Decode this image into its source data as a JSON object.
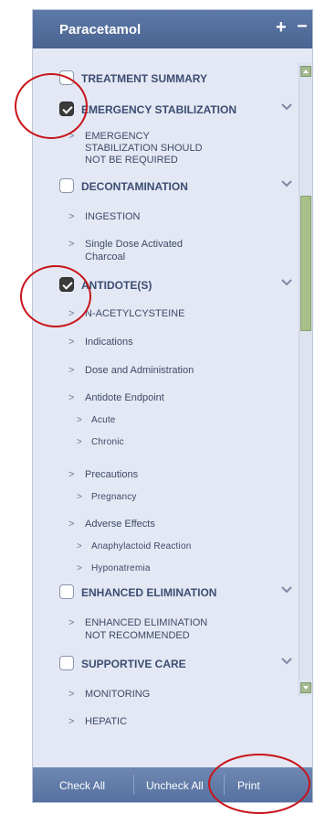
{
  "panel": {
    "title": "Paracetamol",
    "expand_symbol": "+",
    "collapse_symbol": "−"
  },
  "sections": [
    {
      "label": "TREATMENT SUMMARY",
      "checked": false
    },
    {
      "label": "EMERGENCY STABILIZATION",
      "checked": true
    },
    {
      "label": "DECONTAMINATION",
      "checked": false
    },
    {
      "label": "ANTIDOTE(S)",
      "checked": true
    },
    {
      "label": "ENHANCED ELIMINATION",
      "checked": false
    },
    {
      "label": "SUPPORTIVE CARE",
      "checked": false
    }
  ],
  "items": {
    "emergency_1_line1": "EMERGENCY",
    "emergency_1_line2": "STABILIZATION SHOULD",
    "emergency_1_line3": "NOT BE REQUIRED",
    "decon_1": "INGESTION",
    "decon_2_line1": "Single Dose Activated",
    "decon_2_line2": "Charcoal",
    "antidote_1": "N-ACETYLCYSTEINE",
    "antidote_2": "Indications",
    "antidote_3": "Dose and Administration",
    "antidote_4": "Antidote Endpoint",
    "antidote_4a": "Acute",
    "antidote_4b": "Chronic",
    "antidote_5": "Precautions",
    "antidote_5a": "Pregnancy",
    "antidote_6": "Adverse Effects",
    "antidote_6a": "Anaphylactoid Reaction",
    "antidote_6b": "Hyponatremia",
    "enhanced_1_line1": "ENHANCED ELIMINATION",
    "enhanced_1_line2": "NOT RECOMMENDED",
    "supportive_1": "MONITORING",
    "supportive_2": "HEPATIC"
  },
  "arrow_glyph": ">",
  "footer": {
    "check_all": "Check All",
    "uncheck_all": "Uncheck All",
    "print": "Print"
  },
  "colors": {
    "header_bg": "#4a6491",
    "panel_bg": "#e3e8f4",
    "footer_bg": "#5670a0",
    "highlight_ring": "#c8141a"
  }
}
